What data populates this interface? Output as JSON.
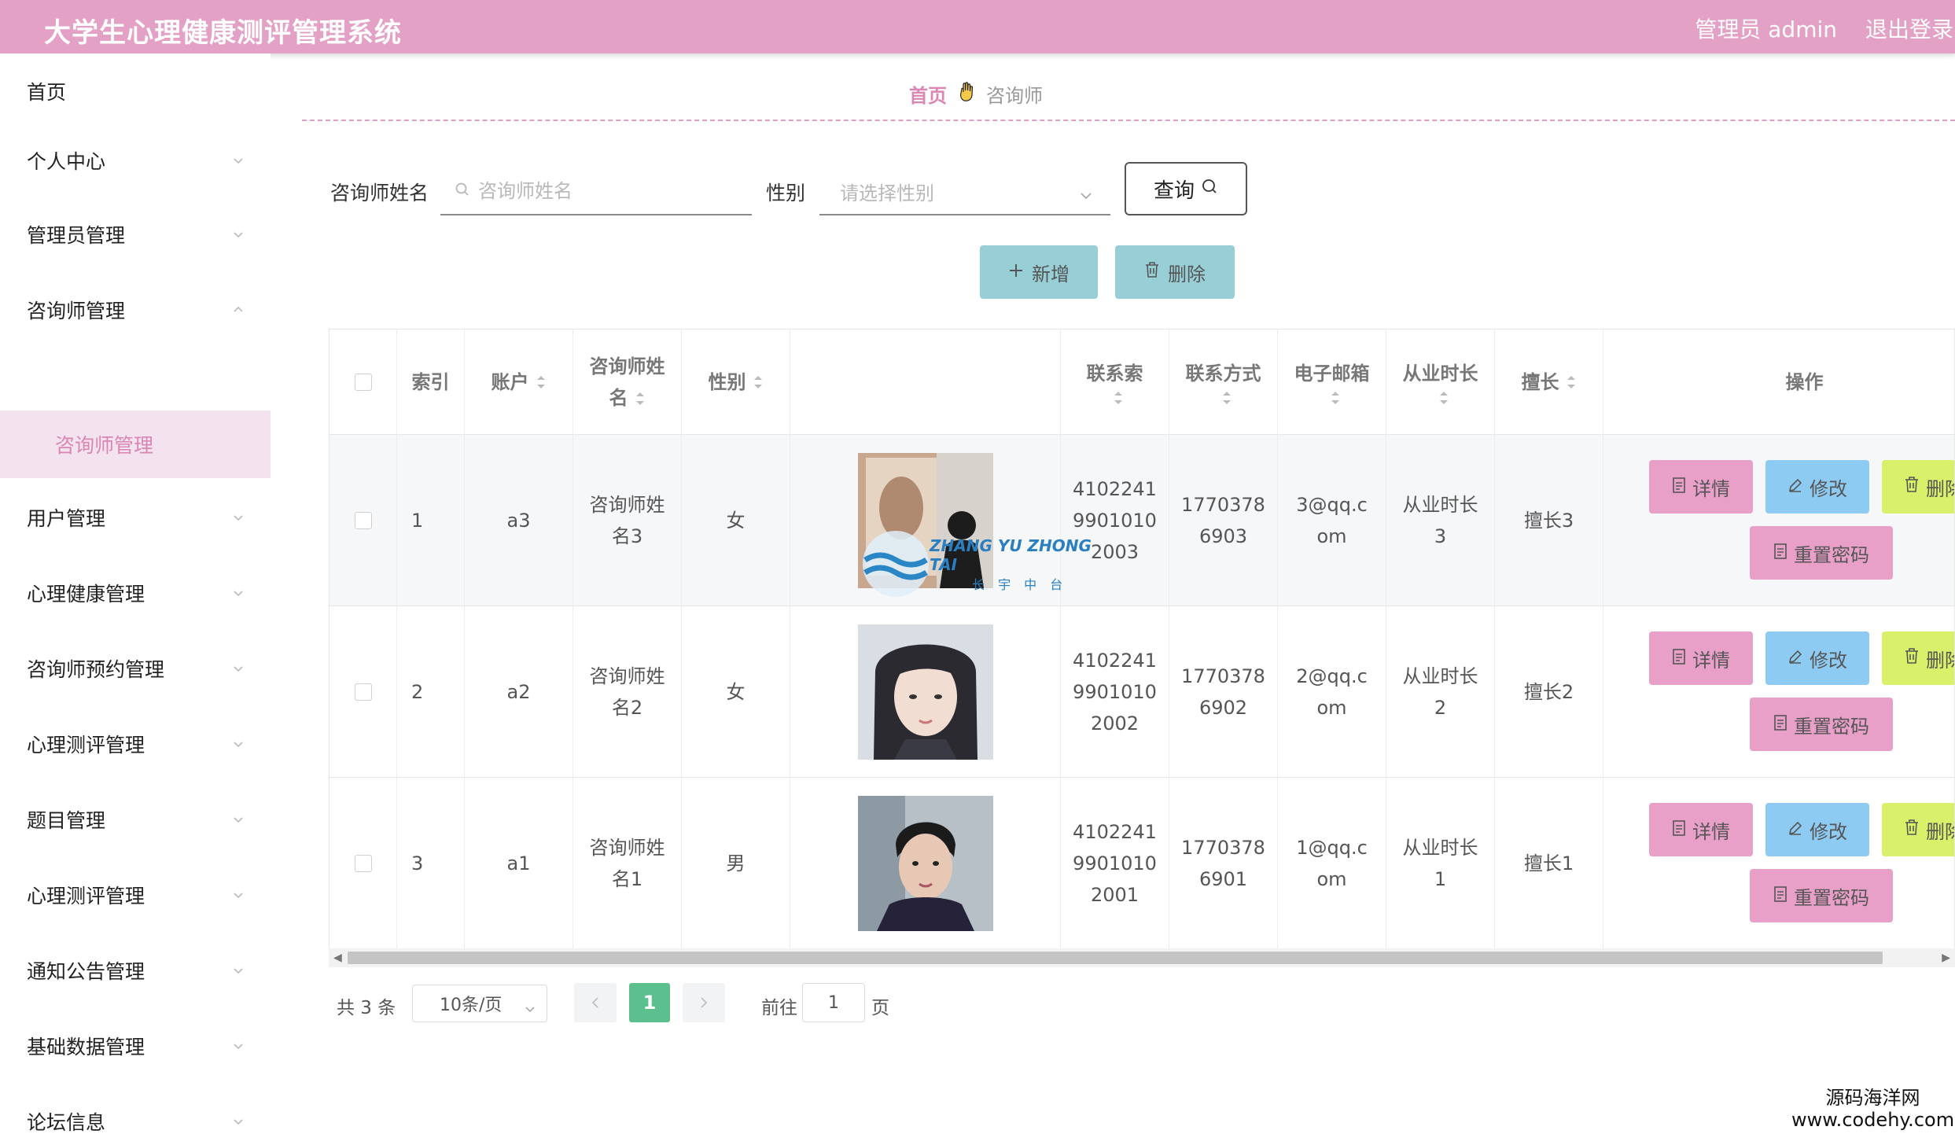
{
  "header": {
    "title": "大学生心理健康测评管理系统",
    "user": "管理员 admin",
    "logout": "退出登录"
  },
  "sidebar": {
    "items": [
      {
        "label": "首页"
      },
      {
        "label": "个人中心"
      },
      {
        "label": "管理员管理"
      },
      {
        "label": "咨询师管理"
      },
      {
        "label": "用户管理"
      },
      {
        "label": "心理健康管理"
      },
      {
        "label": "咨询师预约管理"
      },
      {
        "label": "心理测评管理"
      },
      {
        "label": "题目管理"
      },
      {
        "label": "心理测评管理"
      },
      {
        "label": "通知公告管理"
      },
      {
        "label": "基础数据管理"
      },
      {
        "label": "论坛信息"
      }
    ],
    "active_sub": "咨询师管理"
  },
  "breadcrumb": {
    "home": "首页",
    "current": "咨询师"
  },
  "filters": {
    "name_label": "咨询师姓名",
    "name_placeholder": "咨询师姓名",
    "gender_label": "性别",
    "gender_placeholder": "请选择性别",
    "query": "查询"
  },
  "actions": {
    "add": "新增",
    "delete": "删除"
  },
  "table": {
    "headers": {
      "index": "索引",
      "account": "账户",
      "name_line1": "咨询师姓",
      "name_line2": "名",
      "gender": "性别",
      "idcard": "联系索",
      "phone": "联系方式",
      "email": "电子邮箱",
      "years": "从业时长",
      "specialty": "擅长",
      "ops": "操作"
    },
    "rows": [
      {
        "index": "1",
        "account": "a3",
        "name_line1": "咨询师姓",
        "name_line2": "名3",
        "gender": "女",
        "id1": "4102241",
        "id2": "9901010",
        "id3": "2003",
        "phone1": "1770378",
        "phone2": "6903",
        "email1": "3@qq.c",
        "email2": "om",
        "years1": "从业时长",
        "years2": "3",
        "specialty": "擅长3"
      },
      {
        "index": "2",
        "account": "a2",
        "name_line1": "咨询师姓",
        "name_line2": "名2",
        "gender": "女",
        "id1": "4102241",
        "id2": "9901010",
        "id3": "2002",
        "phone1": "1770378",
        "phone2": "6902",
        "email1": "2@qq.c",
        "email2": "om",
        "years1": "从业时长",
        "years2": "2",
        "specialty": "擅长2"
      },
      {
        "index": "3",
        "account": "a1",
        "name_line1": "咨询师姓",
        "name_line2": "名1",
        "gender": "男",
        "id1": "4102241",
        "id2": "9901010",
        "id3": "2001",
        "phone1": "1770378",
        "phone2": "6901",
        "email1": "1@qq.c",
        "email2": "om",
        "years1": "从业时长",
        "years2": "1",
        "specialty": "擅长1"
      }
    ],
    "op_labels": {
      "detail": "详情",
      "edit": "修改",
      "delete": "删除",
      "reset": "重置密码"
    }
  },
  "pagination": {
    "total": "共 3 条",
    "size": "10条/页",
    "current": "1",
    "goto": "前往",
    "goto_value": "1",
    "page": "页"
  },
  "watermark": {
    "line1": "源码海洋网",
    "line2": "www.codehy.com",
    "overlay1": "ZHANG YU ZHONG TAI",
    "overlay2": "长 宇 中 台"
  },
  "colors": {
    "header": "#e3a1c6",
    "accent": "#d986b4",
    "active_bg": "#f3e3ee",
    "btn_teal": "#98cfd6",
    "btn_blue": "#8ecbf2",
    "btn_lime": "#d9f06a",
    "pager_active": "#5bbf8e"
  }
}
